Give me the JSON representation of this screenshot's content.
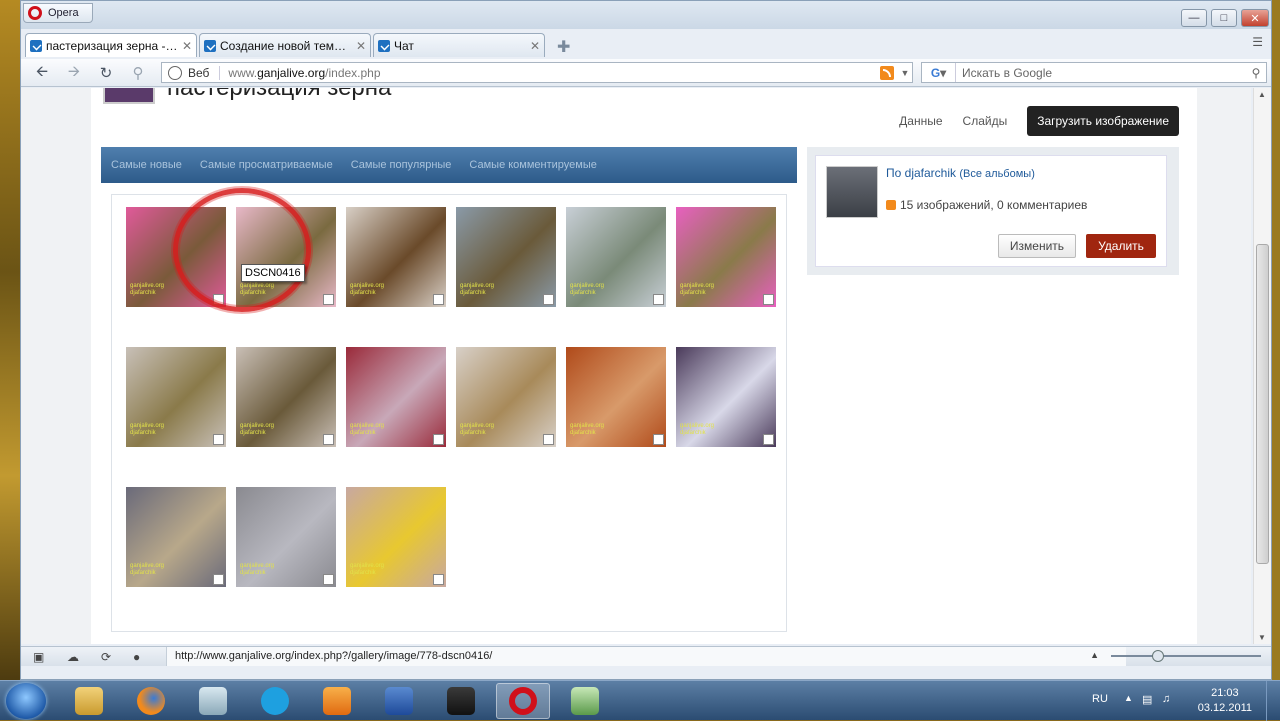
{
  "browser": {
    "menu_label": "Opera",
    "tabs": [
      {
        "title": "пастеризация зерна - ..."
      },
      {
        "title": "Создание новой темы..."
      },
      {
        "title": "Чат"
      }
    ],
    "address": {
      "scheme_label": "Веб",
      "url_prefix": "www.",
      "url_domain": "ganjalive.org",
      "url_path": "/index.php"
    },
    "search": {
      "engine_glyph": "G",
      "placeholder": "Искать в Google"
    },
    "status_url": "http://www.ganjalive.org/index.php?/gallery/image/778-dscn0416/",
    "zoom_fraction": 0.3
  },
  "page": {
    "title": "пастеризация зерна",
    "tabs": {
      "data": "Данные",
      "slides": "Слайды"
    },
    "upload_label": "Загрузить изображение",
    "filters": [
      "Самые новые",
      "Самые просматриваемые",
      "Самые популярные",
      "Самые комментируемые"
    ],
    "tooltip": "DSCN0416",
    "watermark_line1": "ganjalive.org",
    "watermark_line2": "djafarchik",
    "thumbnails": [
      {
        "color_a": "#e05a9a",
        "color_b": "#7a5a3a"
      },
      {
        "color_a": "#e8b8c8",
        "color_b": "#7a6a40"
      },
      {
        "color_a": "#d8cfc6",
        "color_b": "#6a4a2a"
      },
      {
        "color_a": "#8a9aa8",
        "color_b": "#6a5a3a"
      },
      {
        "color_a": "#c8cfd6",
        "color_b": "#7a8a78"
      },
      {
        "color_a": "#e860c0",
        "color_b": "#8a7a4a"
      },
      {
        "color_a": "#c8c0b8",
        "color_b": "#8a7a4a"
      },
      {
        "color_a": "#c9bfb6",
        "color_b": "#6a5a3a"
      },
      {
        "color_a": "#9a2a3a",
        "color_b": "#c8a8b8"
      },
      {
        "color_a": "#d8d0c8",
        "color_b": "#a88a5a"
      },
      {
        "color_a": "#b04a1a",
        "color_b": "#d89a6a"
      },
      {
        "color_a": "#4a3a5a",
        "color_b": "#d8d8e8"
      },
      {
        "color_a": "#6a6a7a",
        "color_b": "#b8a88a"
      },
      {
        "color_a": "#8a8a90",
        "color_b": "#b8b8c0"
      },
      {
        "color_a": "#c8a8a0",
        "color_b": "#e8c830"
      }
    ]
  },
  "sidebar": {
    "by_prefix": "По",
    "author": "djafarchik",
    "all_albums": "Все альбомы",
    "stats": "15 изображений, 0 комментариев",
    "edit_label": "Изменить",
    "delete_label": "Удалить"
  },
  "taskbar": {
    "lang": "RU",
    "time": "21:03",
    "date": "03.12.2011"
  },
  "colors": {
    "accent_blue": "#2d5b8a",
    "delete_red": "#a0260f",
    "highlight_red": "#d81c1c"
  }
}
